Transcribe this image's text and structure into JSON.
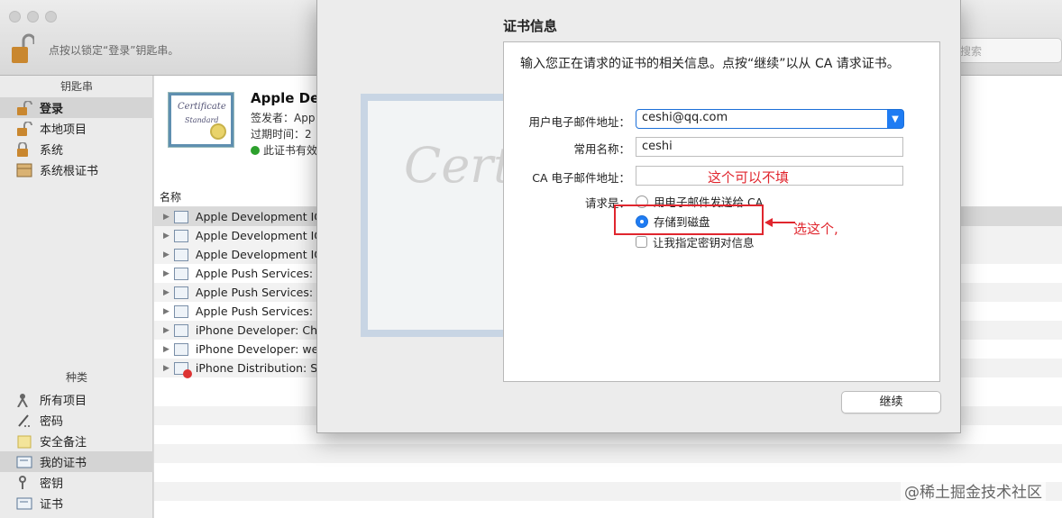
{
  "window": {
    "lock_text": "点按以锁定“登录”钥匙串。",
    "search_placeholder": "搜索"
  },
  "sidebar": {
    "keychains_header": "钥匙串",
    "keychains": [
      {
        "label": "登录",
        "icon": "lock-open-icon",
        "selected": true
      },
      {
        "label": "本地项目",
        "icon": "lock-open-icon",
        "selected": false
      },
      {
        "label": "系统",
        "icon": "lock-closed-icon",
        "selected": false
      },
      {
        "label": "系统根证书",
        "icon": "cabinet-icon",
        "selected": false
      }
    ],
    "category_header": "种类",
    "categories": [
      {
        "label": "所有项目",
        "icon": "people-icon",
        "selected": false
      },
      {
        "label": "密码",
        "icon": "pen-icon",
        "selected": false
      },
      {
        "label": "安全备注",
        "icon": "note-icon",
        "selected": false
      },
      {
        "label": "我的证书",
        "icon": "certificate-icon",
        "selected": true
      },
      {
        "label": "密钥",
        "icon": "key-icon",
        "selected": false
      },
      {
        "label": "证书",
        "icon": "certificate-icon",
        "selected": false
      }
    ]
  },
  "detail": {
    "thumb_text": "Certificate",
    "thumb_sub": "Standard",
    "title": "Apple Devel",
    "issuer": "签发者：App",
    "expires": "过期时间：2",
    "valid": "此证书有效"
  },
  "list": {
    "column_name": "名称",
    "rows": [
      {
        "label": "Apple Development IO",
        "error": false,
        "selected": true
      },
      {
        "label": "Apple Development IO",
        "error": false,
        "selected": false
      },
      {
        "label": "Apple Development IO",
        "error": false,
        "selected": false
      },
      {
        "label": "Apple Push Services:",
        "error": false,
        "selected": false
      },
      {
        "label": "Apple Push Services:",
        "error": false,
        "selected": false
      },
      {
        "label": "Apple Push Services:",
        "error": false,
        "selected": false
      },
      {
        "label": "iPhone Developer: Ch",
        "error": false,
        "selected": false
      },
      {
        "label": "iPhone Developer: we",
        "error": false,
        "selected": false
      },
      {
        "label": "iPhone Distribution: Sh",
        "error": true,
        "selected": false
      }
    ]
  },
  "sheet": {
    "bg_cert_text": "Certif",
    "title": "证书信息",
    "intro": "输入您正在请求的证书的相关信息。点按“继续”以从 CA 请求证书。",
    "email_label": "用户电子邮件地址：",
    "email_value": "ceshi@qq.com",
    "name_label": "常用名称：",
    "name_value": "ceshi",
    "ca_email_label": "CA 电子邮件地址：",
    "ca_email_value": "",
    "request_label": "请求是：",
    "option_email_ca": "用电子邮件发送给 CA",
    "option_save_disk": "存储到磁盘",
    "option_key_pair": "让我指定密钥对信息",
    "selected_option": "存储到磁盘",
    "continue_label": "继续"
  },
  "annotations": {
    "ca_note": "这个可以不填",
    "choose_note": "选这个,",
    "color": "#e0262e"
  },
  "watermark": "@稀土掘金技术社区"
}
